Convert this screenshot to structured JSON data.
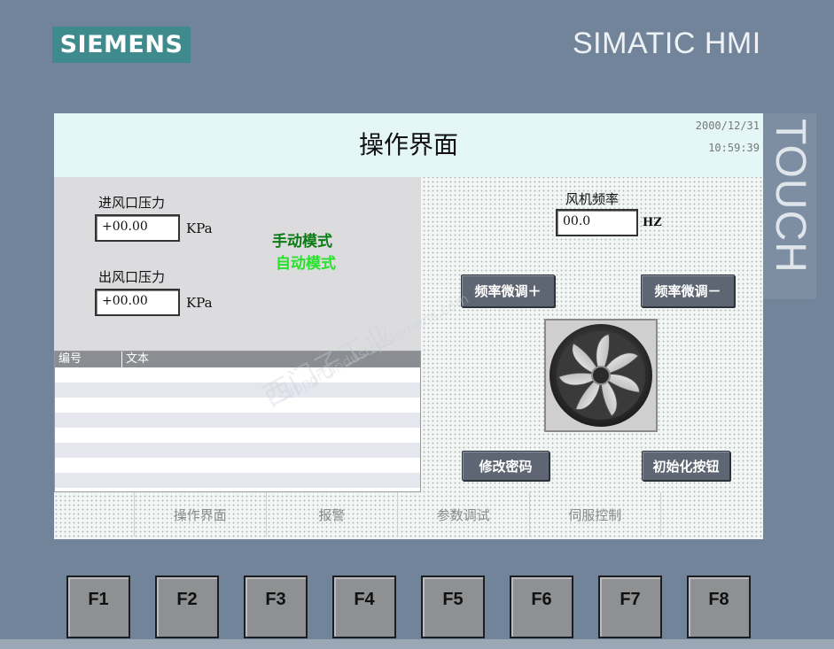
{
  "brand_logo": "SIEMENS",
  "brand_name": "SIMATIC HMI",
  "touch_label": "TOUCH",
  "screen": {
    "title": "操作界面",
    "date": "2000/12/31",
    "time": "10:59:39",
    "inlet": {
      "label": "进风口压力",
      "value": "+00.00",
      "unit": "KPa"
    },
    "outlet": {
      "label": "出风口压力",
      "value": "+00.00",
      "unit": "KPa"
    },
    "modes": {
      "manual": "手动模式",
      "auto": "自动模式",
      "manual_color": "#0a7a12",
      "auto_color": "#27e12a"
    },
    "alarm_table": {
      "col_id": "编号",
      "col_text": "文本"
    },
    "fan_freq": {
      "label": "风机频率",
      "value": "00.0",
      "unit": "HZ"
    },
    "buttons": {
      "freq_up": "频率微调＋",
      "freq_down": "频率微调－",
      "change_pwd": "修改密码",
      "init_button": "初始化按钮"
    },
    "fan_icon": "fan-icon",
    "nav": [
      "操作界面",
      "报警",
      "参数调试",
      "伺服控制"
    ]
  },
  "watermark": {
    "line1": "西门子工业",
    "line2": "support.industry.siemens.com"
  },
  "fkeys": [
    "F1",
    "F2",
    "F3",
    "F4",
    "F5",
    "F6",
    "F7",
    "F8"
  ]
}
